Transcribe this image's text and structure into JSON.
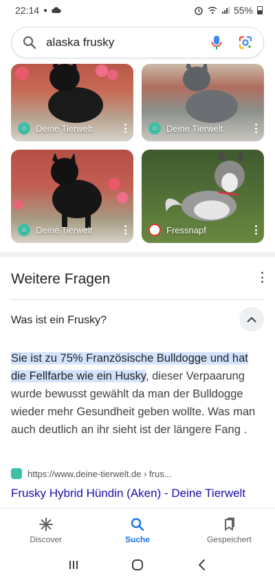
{
  "status_bar": {
    "time": "22:14",
    "battery": "55%"
  },
  "search": {
    "query": "alaska frusky"
  },
  "image_results": [
    {
      "source": "Deine Tierwelt",
      "icon": "deine-tierwelt-logo"
    },
    {
      "source": "Deine Tierwelt",
      "icon": "deine-tierwelt-logo"
    },
    {
      "source": "Deine Tierwelt",
      "icon": "deine-tierwelt-logo"
    },
    {
      "source": "Fressnapf",
      "icon": "fressnapf-logo"
    }
  ],
  "related_questions": {
    "title": "Weitere Fragen",
    "question": "Was ist ein Frusky?",
    "answer_highlight": "Sie ist zu 75% Französische Bulldogge und hat die Fellfarbe wie ein Husky",
    "answer_rest": ", dieser Verpaarung wurde bewusst gewählt da man der Bulldogge wieder mehr Gesundheit geben wollte. Was man auch deutlich an ihr sieht ist der längere Fang .",
    "source_url": "https://www.deine-tierwelt.de › frus...",
    "result_title": "Frusky Hybrid Hündin (Aken) - Deine Tierwelt"
  },
  "bottom_nav": {
    "items": [
      {
        "label": "Discover",
        "icon": "asterisk-icon"
      },
      {
        "label": "Suche",
        "icon": "search-icon"
      },
      {
        "label": "Gespeichert",
        "icon": "bookmarks-icon"
      }
    ],
    "active": "Suche"
  },
  "colors": {
    "accent": "#1a73e8",
    "link": "#1a0dab",
    "highlight": "#d3e3fd"
  }
}
